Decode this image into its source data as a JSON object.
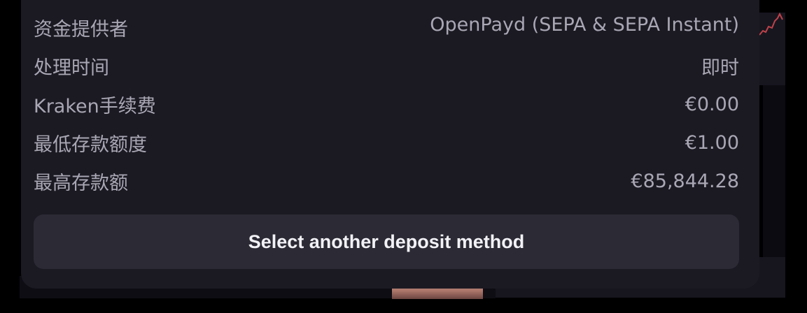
{
  "details": {
    "rows": [
      {
        "label": "资金提供者",
        "value": "OpenPayd (SEPA & SEPA Instant)"
      },
      {
        "label": "处理时间",
        "value": "即时"
      },
      {
        "label": "Kraken手续费",
        "value": "€0.00"
      },
      {
        "label": "最低存款额度",
        "value": "€1.00"
      },
      {
        "label": "最高存款额",
        "value": "€85,844.28"
      }
    ]
  },
  "actions": {
    "select_another_label": "Select another deposit method"
  },
  "colors": {
    "modal_bg": "#1b1a23",
    "button_bg": "#2c2b35",
    "text_muted": "#a9a7b3",
    "text_button": "#f2f1f6",
    "sparkline": "#c0424a"
  }
}
